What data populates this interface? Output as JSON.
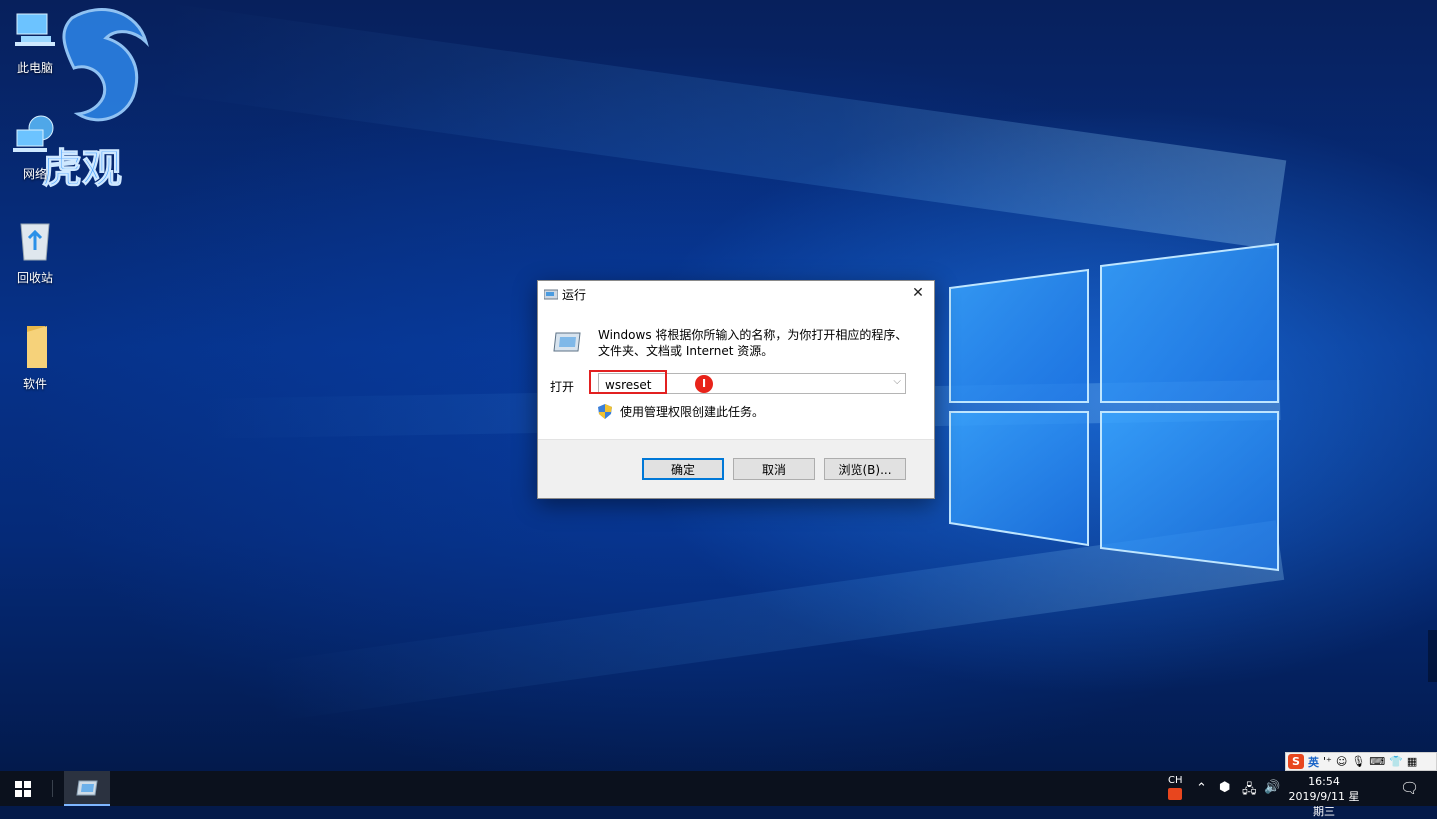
{
  "desktop": {
    "icons": [
      {
        "label": "此电脑",
        "icon": "this-pc-icon"
      },
      {
        "label": "网络",
        "icon": "network-icon"
      },
      {
        "label": "回收站",
        "icon": "recycle-bin-icon"
      },
      {
        "label": "软件",
        "icon": "folder-icon"
      }
    ],
    "watermark": "虎观"
  },
  "run_dialog": {
    "title": "运行",
    "description": "Windows 将根据你所输入的名称，为你打开相应的程序、文件夹、文档或 Internet 资源。",
    "open_label": "打开",
    "open_value": "wsreset",
    "admin_note": "使用管理权限创建此任务。",
    "ok_label": "确定",
    "cancel_label": "取消",
    "browse_label": "浏览(B)...",
    "close_glyph": "✕"
  },
  "ime": {
    "lang": "英",
    "brand": "S"
  },
  "taskbar": {
    "lang_indicator": "CH",
    "time": "16:54",
    "date": "2019/9/11 星期三"
  },
  "colors": {
    "accent": "#0078d7",
    "highlight_box": "#e22020"
  }
}
